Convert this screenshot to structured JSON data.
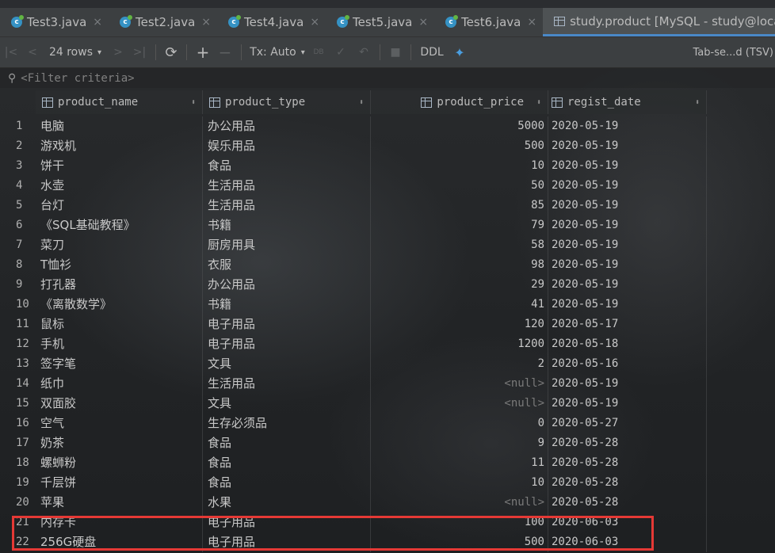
{
  "tabs": [
    {
      "label": "Test3.java",
      "close": "×"
    },
    {
      "label": "Test2.java",
      "close": "×"
    },
    {
      "label": "Test4.java",
      "close": "×"
    },
    {
      "label": "Test5.java",
      "close": "×"
    },
    {
      "label": "Test6.java",
      "close": "×"
    },
    {
      "label": "study.product [MySQL - study@local",
      "active": true
    }
  ],
  "toolbar": {
    "rows": "24 rows",
    "tx": "Tx: Auto",
    "ddl": "DDL",
    "export": "Tab-se...d (TSV)"
  },
  "filter": {
    "placeholder": "<Filter criteria>"
  },
  "columns": [
    "product_name",
    "product_type",
    "product_price",
    "regist_date"
  ],
  "rows": [
    {
      "n": "1",
      "name": "电脑",
      "type": "办公用品",
      "price": "5000",
      "date": "2020-05-19"
    },
    {
      "n": "2",
      "name": "游戏机",
      "type": "娱乐用品",
      "price": "500",
      "date": "2020-05-19"
    },
    {
      "n": "3",
      "name": "饼干",
      "type": "食品",
      "price": "10",
      "date": "2020-05-19"
    },
    {
      "n": "4",
      "name": "水壶",
      "type": "生活用品",
      "price": "50",
      "date": "2020-05-19"
    },
    {
      "n": "5",
      "name": "台灯",
      "type": "生活用品",
      "price": "85",
      "date": "2020-05-19"
    },
    {
      "n": "6",
      "name": "《SQL基础教程》",
      "type": "书籍",
      "price": "79",
      "date": "2020-05-19"
    },
    {
      "n": "7",
      "name": "菜刀",
      "type": "厨房用具",
      "price": "58",
      "date": "2020-05-19"
    },
    {
      "n": "8",
      "name": "T恤衫",
      "type": "衣服",
      "price": "98",
      "date": "2020-05-19"
    },
    {
      "n": "9",
      "name": "打孔器",
      "type": "办公用品",
      "price": "29",
      "date": "2020-05-19"
    },
    {
      "n": "10",
      "name": "《离散数学》",
      "type": "书籍",
      "price": "41",
      "date": "2020-05-19"
    },
    {
      "n": "11",
      "name": "鼠标",
      "type": "电子用品",
      "price": "120",
      "date": "2020-05-17"
    },
    {
      "n": "12",
      "name": "手机",
      "type": "电子用品",
      "price": "1200",
      "date": "2020-05-18"
    },
    {
      "n": "13",
      "name": "签字笔",
      "type": "文具",
      "price": "2",
      "date": "2020-05-16"
    },
    {
      "n": "14",
      "name": "纸巾",
      "type": "生活用品",
      "price": "<null>",
      "date": "2020-05-19"
    },
    {
      "n": "15",
      "name": "双面胶",
      "type": "文具",
      "price": "<null>",
      "date": "2020-05-19"
    },
    {
      "n": "16",
      "name": "空气",
      "type": "生存必须品",
      "price": "0",
      "date": "2020-05-27"
    },
    {
      "n": "17",
      "name": "奶茶",
      "type": "食品",
      "price": "9",
      "date": "2020-05-28"
    },
    {
      "n": "18",
      "name": "螺蛳粉",
      "type": "食品",
      "price": "11",
      "date": "2020-05-28"
    },
    {
      "n": "19",
      "name": "千层饼",
      "type": "食品",
      "price": "10",
      "date": "2020-05-28"
    },
    {
      "n": "20",
      "name": "苹果",
      "type": "水果",
      "price": "<null>",
      "date": "2020-05-28"
    },
    {
      "n": "21",
      "name": "内存卡",
      "type": "电子用品",
      "price": "100",
      "date": "2020-06-03"
    },
    {
      "n": "22",
      "name": "256G硬盘",
      "type": "电子用品",
      "price": "500",
      "date": "2020-06-03"
    }
  ],
  "colors": {
    "highlight_box": "#e53935",
    "tab_active_underline": "#4a88c7"
  }
}
